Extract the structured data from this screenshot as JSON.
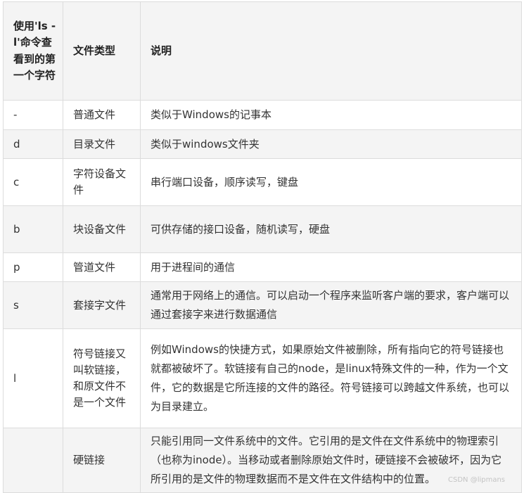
{
  "headers": {
    "first_char": "使用'ls -l'命令查看到的第一个字符",
    "file_type": "文件类型",
    "description": "说明"
  },
  "rows": [
    {
      "char": "-",
      "type": "普通文件",
      "desc": "类似于Windows的记事本"
    },
    {
      "char": "d",
      "type": "目录文件",
      "desc": "类似于windows文件夹"
    },
    {
      "char": "c",
      "type": "字符设备文件",
      "desc": "串行端口设备，顺序读写，键盘"
    },
    {
      "char": "b",
      "type": "块设备文件",
      "desc": "可供存储的接口设备，随机读写，硬盘"
    },
    {
      "char": "p",
      "type": "管道文件",
      "desc": "用于进程间的通信"
    },
    {
      "char": "s",
      "type": "套接字文件",
      "desc": "通常用于网络上的通信。可以启动一个程序来监听客户端的要求，客户端可以通过套接字来进行数据通信"
    },
    {
      "char": "l",
      "type": "符号链接又叫软链接，和原文件不是一个文件",
      "desc": "例如Windows的快捷方式，如果原始文件被删除，所有指向它的符号链接也就都被破坏了。软链接有自己的node，是linux特殊文件的一种，作为一个文件，它的数据是它所连接的文件的路径。符号链接可以跨越文件系统，也可以为目录建立。"
    },
    {
      "char": "",
      "type": "硬链接",
      "desc": "只能引用同一文件系统中的文件。它引用的是文件在文件系统中的物理索引（也称为inode）。当移动或者删除原始文件时，硬链接不会被破坏，因为它所引用的是文件的物理数据而不是文件在文件结构中的位置。"
    }
  ],
  "watermark": "CSDN @lipmans"
}
